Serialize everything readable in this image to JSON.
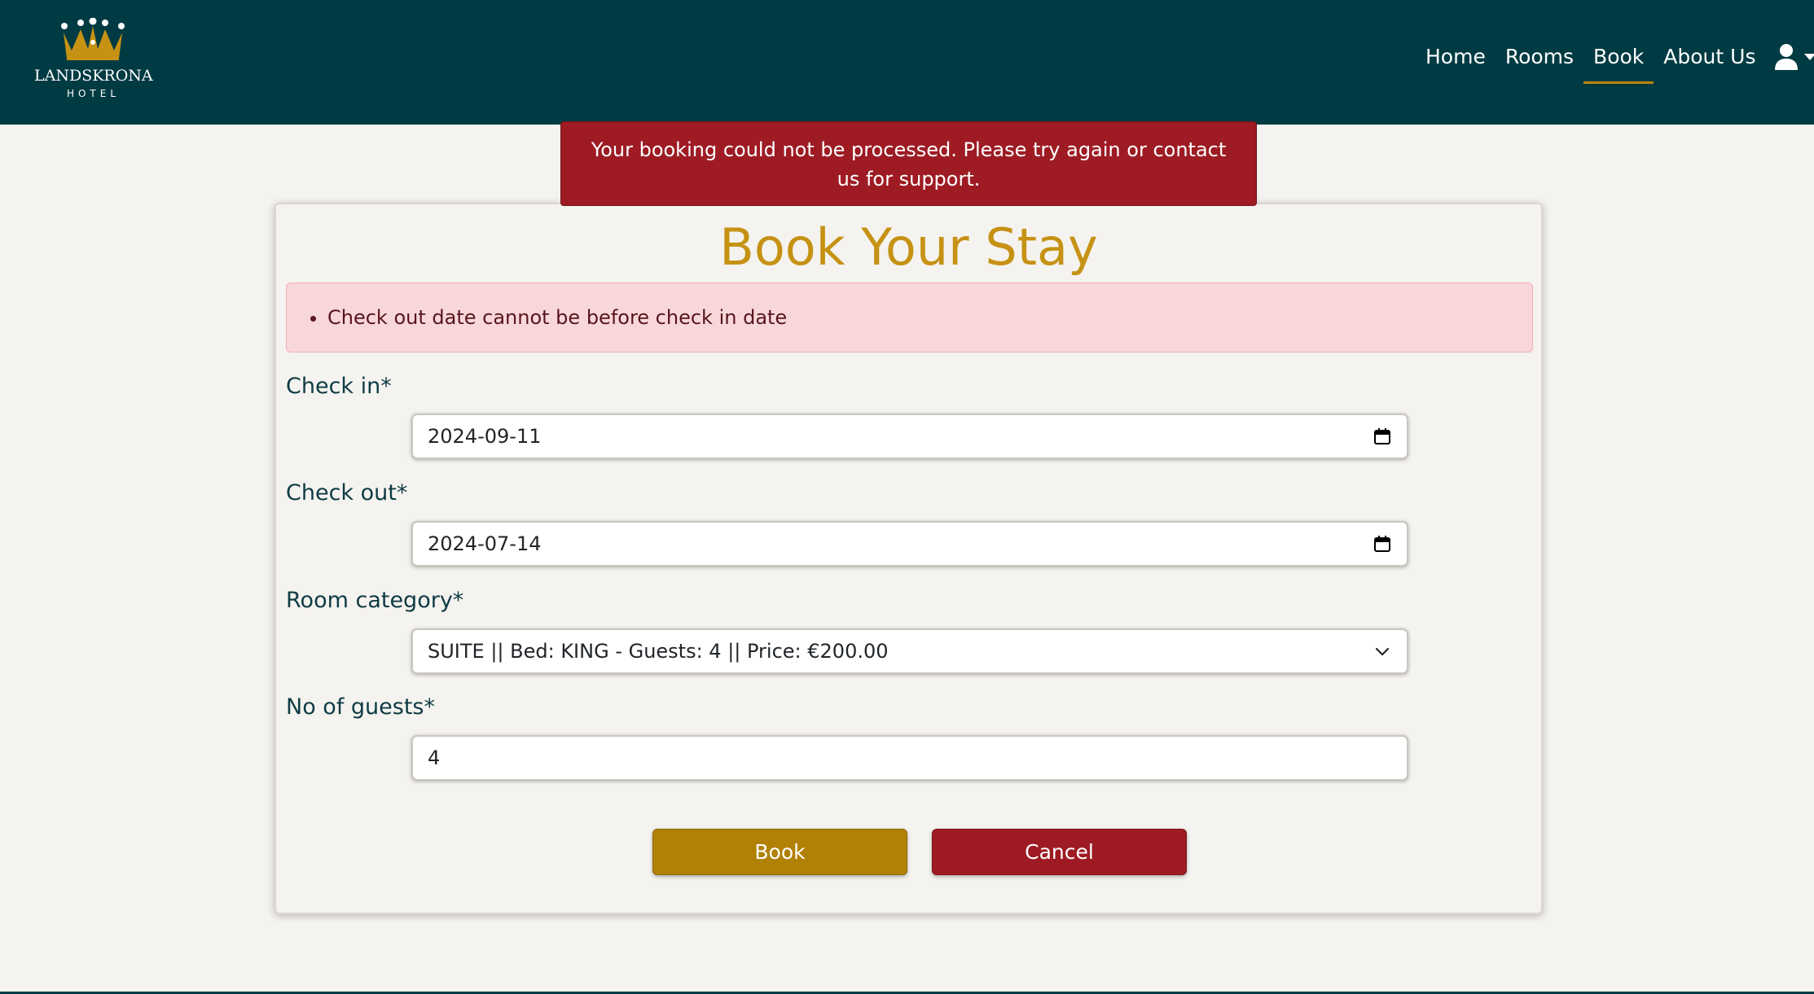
{
  "brand": {
    "name": "LANDSKRONA",
    "subtitle": "HOTEL",
    "crown_color": "#c69214"
  },
  "nav": {
    "links": [
      {
        "label": "Home",
        "active": false
      },
      {
        "label": "Rooms",
        "active": false
      },
      {
        "label": "Book",
        "active": true
      },
      {
        "label": "About Us",
        "active": false
      }
    ],
    "user_icon": "user-icon",
    "accent_color": "#b8860b",
    "background": "#003b43"
  },
  "alert": {
    "message": "Your booking could not be processed. Please try again or contact us for support.",
    "color": "#9e1b24"
  },
  "form": {
    "title": "Book Your Stay",
    "errors": [
      "Check out date cannot be before check in date"
    ],
    "check_in": {
      "label": "Check in*",
      "value": "2024-09-11",
      "icon": "calendar-icon"
    },
    "check_out": {
      "label": "Check out*",
      "value": "2024-07-14",
      "icon": "calendar-icon"
    },
    "room_category": {
      "label": "Room category*",
      "value": "SUITE || Bed: KING - Guests: 4 || Price: €200.00",
      "icon": "chevron-down-icon"
    },
    "guests": {
      "label": "No of guests*",
      "value": "4"
    },
    "book_label": "Book",
    "cancel_label": "Cancel",
    "book_color": "#b08104",
    "cancel_color": "#9e1b24"
  }
}
